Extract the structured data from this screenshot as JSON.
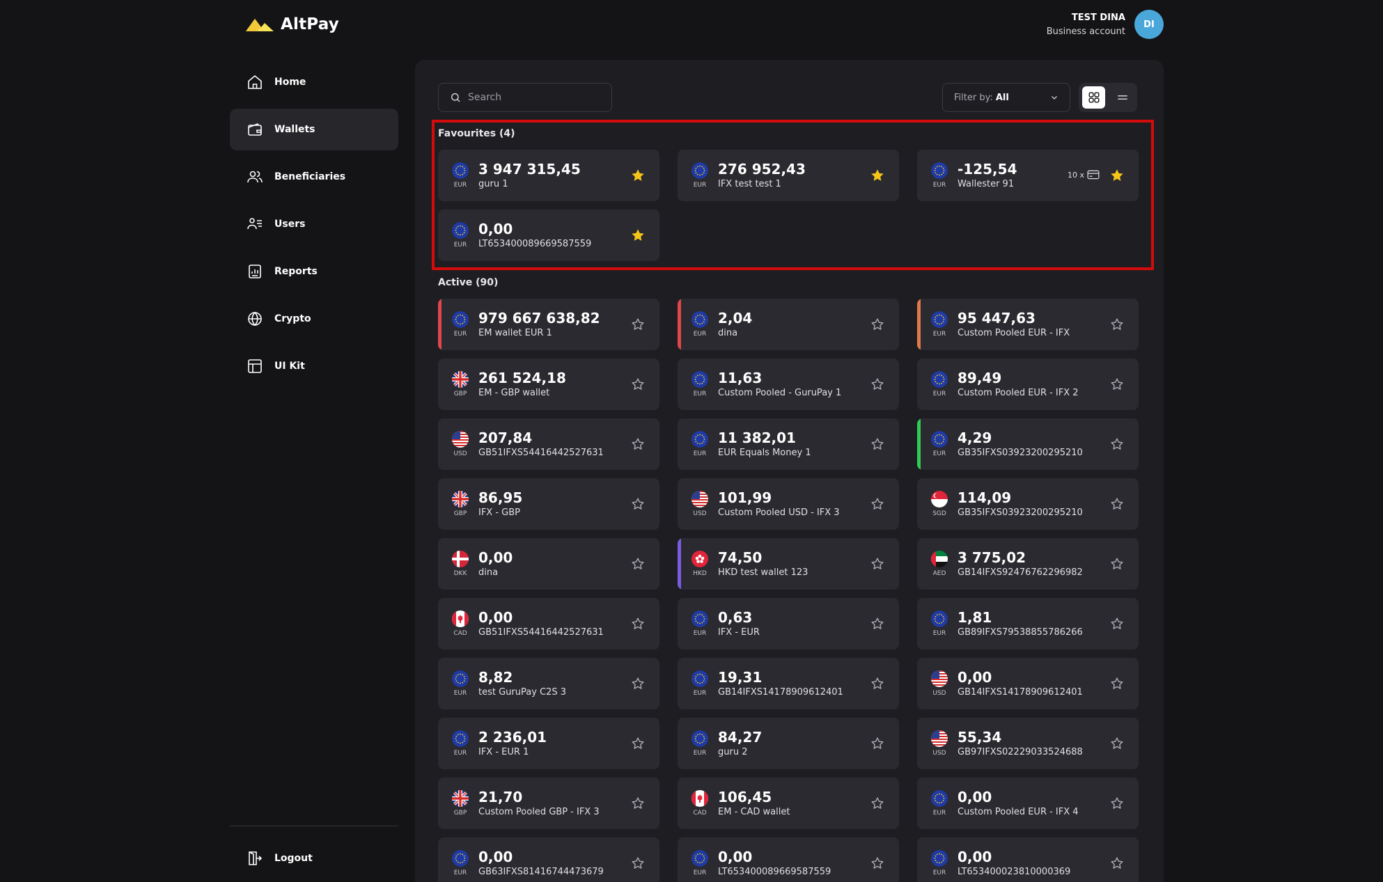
{
  "app": {
    "name": "AltPay"
  },
  "user": {
    "name": "TEST DINA",
    "account_type": "Business account",
    "initials": "DI",
    "avatar_color": "#4aa7d9"
  },
  "nav": [
    {
      "label": "Home",
      "icon": "home-icon",
      "active": false
    },
    {
      "label": "Wallets",
      "icon": "wallet-icon",
      "active": true
    },
    {
      "label": "Beneficiaries",
      "icon": "users-icon",
      "active": false
    },
    {
      "label": "Users",
      "icon": "user-list-icon",
      "active": false
    },
    {
      "label": "Reports",
      "icon": "report-icon",
      "active": false
    },
    {
      "label": "Crypto",
      "icon": "globe-icon",
      "active": false
    },
    {
      "label": "UI Kit",
      "icon": "layout-icon",
      "active": false
    }
  ],
  "logout_label": "Logout",
  "search": {
    "placeholder": "Search"
  },
  "filter": {
    "label": "Filter by:",
    "value": "All"
  },
  "colors": {
    "star_filled": "#f5c518",
    "highlight_border": "#d40b0b"
  },
  "favourites": {
    "title": "Favourites (4)",
    "wallets": [
      {
        "amount": "3 947 315,45",
        "name": "guru 1",
        "currency": "EUR",
        "starred": true
      },
      {
        "amount": "276 952,43",
        "name": "IFX test test 1",
        "currency": "EUR",
        "starred": true
      },
      {
        "amount": "-125,54",
        "name": "Wallester 91",
        "currency": "EUR",
        "starred": true,
        "cards_count": "10 x"
      },
      {
        "amount": "0,00",
        "name": "LT653400089669587559",
        "currency": "EUR",
        "starred": true
      }
    ]
  },
  "active": {
    "title": "Active (90)",
    "wallets": [
      {
        "amount": "979 667 638,82",
        "name": "EM wallet EUR 1",
        "currency": "EUR",
        "accent": "#e0464b"
      },
      {
        "amount": "2,04",
        "name": "dina",
        "currency": "EUR",
        "accent": "#e0464b"
      },
      {
        "amount": "95 447,63",
        "name": "Custom Pooled EUR - IFX",
        "currency": "EUR",
        "accent": "#e07a4a"
      },
      {
        "amount": "261 524,18",
        "name": "EM - GBP wallet",
        "currency": "GBP"
      },
      {
        "amount": "11,63",
        "name": "Custom Pooled - GuruPay 1",
        "currency": "EUR"
      },
      {
        "amount": "89,49",
        "name": "Custom Pooled EUR - IFX 2",
        "currency": "EUR"
      },
      {
        "amount": "207,84",
        "name": "GB51IFXS54416442527631",
        "currency": "USD"
      },
      {
        "amount": "11 382,01",
        "name": "EUR Equals Money 1",
        "currency": "EUR"
      },
      {
        "amount": "4,29",
        "name": "GB35IFXS03923200295210",
        "currency": "EUR",
        "accent": "#2ecc55"
      },
      {
        "amount": "86,95",
        "name": "IFX - GBP",
        "currency": "GBP"
      },
      {
        "amount": "101,99",
        "name": "Custom Pooled USD - IFX 3",
        "currency": "USD"
      },
      {
        "amount": "114,09",
        "name": "GB35IFXS03923200295210",
        "currency": "SGD"
      },
      {
        "amount": "0,00",
        "name": "dina",
        "currency": "DKK"
      },
      {
        "amount": "74,50",
        "name": "HKD test wallet 123",
        "currency": "HKD",
        "accent": "#7a5ce0"
      },
      {
        "amount": "3 775,02",
        "name": "GB14IFXS92476762296982",
        "currency": "AED"
      },
      {
        "amount": "0,00",
        "name": "GB51IFXS54416442527631",
        "currency": "CAD"
      },
      {
        "amount": "0,63",
        "name": "IFX - EUR",
        "currency": "EUR"
      },
      {
        "amount": "1,81",
        "name": "GB89IFXS79538855786266",
        "currency": "EUR"
      },
      {
        "amount": "8,82",
        "name": "test GuruPay C2S 3",
        "currency": "EUR"
      },
      {
        "amount": "19,31",
        "name": "GB14IFXS14178909612401",
        "currency": "EUR"
      },
      {
        "amount": "0,00",
        "name": "GB14IFXS14178909612401",
        "currency": "USD"
      },
      {
        "amount": "2 236,01",
        "name": "IFX - EUR 1",
        "currency": "EUR"
      },
      {
        "amount": "84,27",
        "name": "guru 2",
        "currency": "EUR"
      },
      {
        "amount": "55,34",
        "name": "GB97IFXS02229033524688",
        "currency": "USD"
      },
      {
        "amount": "21,70",
        "name": "Custom Pooled GBP - IFX 3",
        "currency": "GBP"
      },
      {
        "amount": "106,45",
        "name": "EM - CAD wallet",
        "currency": "CAD"
      },
      {
        "amount": "0,00",
        "name": "Custom Pooled EUR - IFX 4",
        "currency": "EUR"
      },
      {
        "amount": "0,00",
        "name": "GB63IFXS81416744473679",
        "currency": "EUR"
      },
      {
        "amount": "0,00",
        "name": "LT653400089669587559",
        "currency": "EUR"
      },
      {
        "amount": "0,00",
        "name": "LT653400023810000369",
        "currency": "EUR"
      }
    ]
  }
}
